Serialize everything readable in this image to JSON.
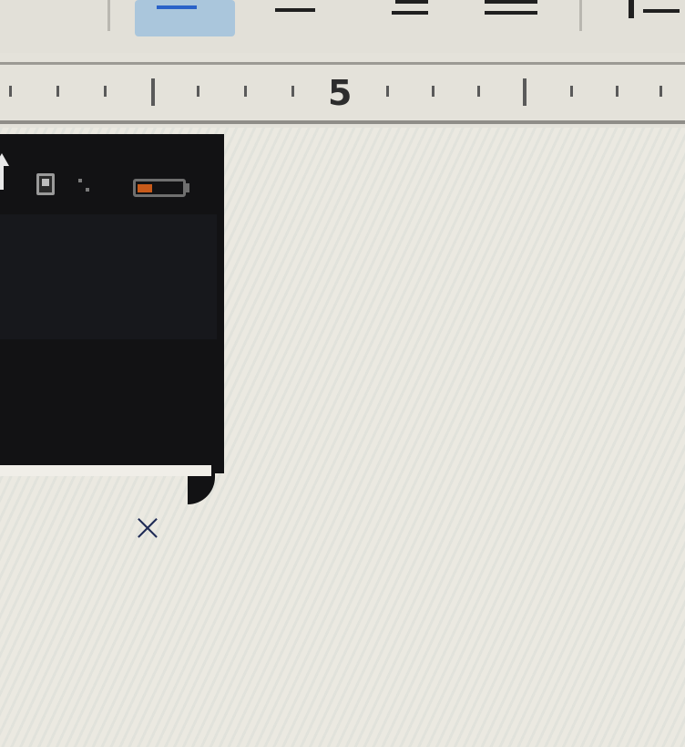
{
  "toolbar": {
    "buttons": [
      {
        "icon": "align-left-icon",
        "active": true
      },
      {
        "icon": "align-center-icon",
        "active": false
      },
      {
        "icon": "align-right-icon",
        "active": false
      },
      {
        "icon": "justify-icon",
        "active": false
      },
      {
        "icon": "line-spacing-icon",
        "active": false
      }
    ],
    "active_color": "#aac6dc"
  },
  "ruler": {
    "label": "5"
  },
  "popup": {
    "background": "#121214",
    "battery_color": "#c85a1a",
    "close_symbol": "×",
    "icons": [
      "arrow-up-icon",
      "disk-icon",
      "signal-icon",
      "battery-icon",
      "close-icon"
    ]
  }
}
